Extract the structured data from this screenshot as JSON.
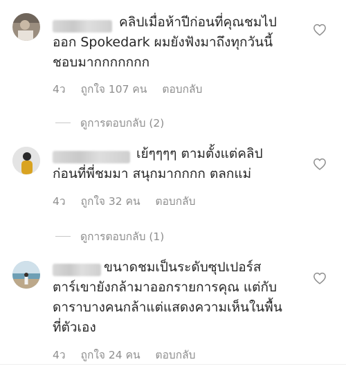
{
  "comments": [
    {
      "text_lines": "คลิปเมื่อห้าปีก่อนที่คุณชมไป\nออก Spokedark ผมยังฟังมาถึงทุกวันนี้\nชอบมากกกกกกก",
      "time": "4ว",
      "likes": "ถูกใจ 107 คน",
      "reply": "ตอบกลับ",
      "view_replies": "ดูการตอบกลับ (2)"
    },
    {
      "text_lines": "เย้ๆๆๆๆ ตามตั้งแต่คลิป\nก่อนที่พี่ชมมา สนุกมากกกก ตลกแม่",
      "time": "4ว",
      "likes": "ถูกใจ 32 คน",
      "reply": "ตอบกลับ",
      "view_replies": "ดูการตอบกลับ (1)"
    },
    {
      "text_lines": "ขนาดชมเป็นระดับซุปเปอร์ส\nตาร์เขายังกล้ามาออกรายการคุณ แต่กับ\nดาราบางคนกล้าแต่แสดงความเห็นในพื้น\nที่ตัวเอง",
      "time": "4ว",
      "likes": "ถูกใจ 24 คน",
      "reply": "ตอบกลับ"
    }
  ],
  "icons": {
    "like": "heart-outline-icon"
  },
  "colors": {
    "text": "#262626",
    "secondary": "#8e8e8e"
  }
}
